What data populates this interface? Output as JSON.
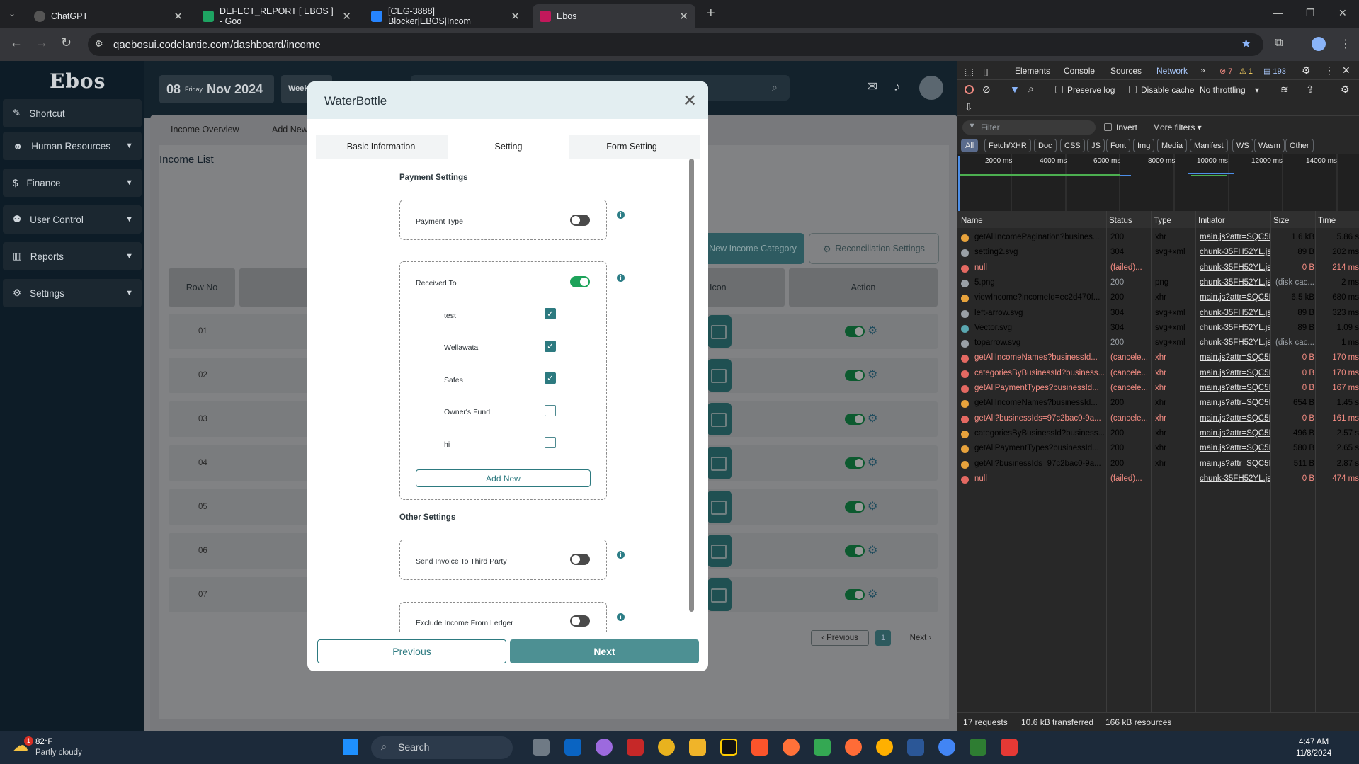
{
  "browser": {
    "tabs": [
      {
        "title": "ChatGPT",
        "icon": "chatgpt-icon"
      },
      {
        "title": "DEFECT_REPORT [ EBOS ] - Goo",
        "icon": "sheets-icon"
      },
      {
        "title": "[CEG-3888] Blocker|EBOS|Incom",
        "icon": "jira-icon"
      },
      {
        "title": "Ebos",
        "icon": "ebos-icon"
      }
    ],
    "url": "qaebosui.codelantic.com/dashboard/income"
  },
  "sidebar": {
    "logo": "Ebos",
    "items": [
      {
        "label": "Shortcut",
        "icon": "pin-icon"
      },
      {
        "label": "Human Resources",
        "icon": "people-icon"
      },
      {
        "label": "Finance",
        "icon": "dollar-icon"
      },
      {
        "label": "User Control",
        "icon": "user-control-icon"
      },
      {
        "label": "Reports",
        "icon": "chart-icon"
      },
      {
        "label": "Settings",
        "icon": "gear-icon"
      }
    ]
  },
  "topbar": {
    "day": "08",
    "weekday": "Friday",
    "month_year": "Nov 2024",
    "week": "Week"
  },
  "page": {
    "tabs": [
      "Income Overview",
      "Add New"
    ],
    "title": "Income List",
    "buttons": {
      "new_category": "New Income Category",
      "reconciliation": "Reconciliation Settings"
    },
    "columns": [
      "Row No",
      "Icon",
      "Action"
    ],
    "rows": [
      "01",
      "02",
      "03",
      "04",
      "05",
      "06",
      "07"
    ],
    "pagination": {
      "previous": "Previous",
      "page": "1",
      "next": "Next"
    }
  },
  "modal": {
    "title": "WaterBottle",
    "tabs": [
      "Basic Information",
      "Setting",
      "Form Setting"
    ],
    "payment_settings_title": "Payment Settings",
    "payment_type_label": "Payment Type",
    "received_to_label": "Received To",
    "received_to_options": [
      {
        "label": "test",
        "checked": true
      },
      {
        "label": "Wellawata",
        "checked": true
      },
      {
        "label": "Safes",
        "checked": true
      },
      {
        "label": "Owner's Fund",
        "checked": false
      },
      {
        "label": "hi",
        "checked": false
      }
    ],
    "add_new_label": "Add New",
    "other_settings_title": "Other Settings",
    "send_invoice_label": "Send Invoice To Third Party",
    "exclude_income_label": "Exclude Income From Ledger",
    "previous_label": "Previous",
    "next_label": "Next"
  },
  "devtools": {
    "tabs": [
      "Elements",
      "Console",
      "Sources",
      "Network"
    ],
    "errors": "7",
    "warnings": "1",
    "messages": "193",
    "preserve_log": "Preserve log",
    "disable_cache": "Disable cache",
    "throttling": "No throttling",
    "filter_placeholder": "Filter",
    "invert": "Invert",
    "more_filters": "More filters",
    "type_filters": [
      "All",
      "Fetch/XHR",
      "Doc",
      "CSS",
      "JS",
      "Font",
      "Img",
      "Media",
      "Manifest",
      "WS",
      "Wasm",
      "Other"
    ],
    "timeline_ticks": [
      "2000 ms",
      "4000 ms",
      "6000 ms",
      "8000 ms",
      "10000 ms",
      "12000 ms",
      "14000 ms"
    ],
    "columns": [
      "Name",
      "Status",
      "Type",
      "Initiator",
      "Size",
      "Time"
    ],
    "requests": [
      {
        "name": "getAllIncomePagination?busines...",
        "status": "200",
        "type": "xhr",
        "initiator": "main.js?attr=SQC5I",
        "size": "1.6 kB",
        "time": "5.86 s",
        "color": "#e8a33c"
      },
      {
        "name": "setting2.svg",
        "status": "304",
        "type": "svg+xml",
        "initiator": "chunk-35FH52YL.js",
        "size": "89 B",
        "time": "202 ms",
        "color": "#9aa0a6"
      },
      {
        "name": "null",
        "status": "(failed)...",
        "type": "",
        "initiator": "chunk-35FH52YL.js",
        "size": "0 B",
        "time": "214 ms",
        "color": "#e46962"
      },
      {
        "name": "5.png",
        "status": "200",
        "type": "png",
        "initiator": "chunk-35FH52YL.js",
        "size": "(disk cac...",
        "time": "2 ms",
        "color": "#9aa0a6"
      },
      {
        "name": "viewIncome?incomeId=ec2d470f...",
        "status": "200",
        "type": "xhr",
        "initiator": "main.js?attr=SQC5I",
        "size": "6.5 kB",
        "time": "680 ms",
        "color": "#e8a33c"
      },
      {
        "name": "left-arrow.svg",
        "status": "304",
        "type": "svg+xml",
        "initiator": "chunk-35FH52YL.js",
        "size": "89 B",
        "time": "323 ms",
        "color": "#9aa0a6"
      },
      {
        "name": "Vector.svg",
        "status": "304",
        "type": "svg+xml",
        "initiator": "chunk-35FH52YL.js",
        "size": "89 B",
        "time": "1.09 s",
        "color": "#5aa7b0"
      },
      {
        "name": "toparrow.svg",
        "status": "200",
        "type": "svg+xml",
        "initiator": "chunk-35FH52YL.js",
        "size": "(disk cac...",
        "time": "1 ms",
        "color": "#9aa0a6"
      },
      {
        "name": "getAllIncomeNames?businessId...",
        "status": "(cancele...",
        "type": "xhr",
        "initiator": "main.js?attr=SQC5I",
        "size": "0 B",
        "time": "170 ms",
        "color": "#e46962"
      },
      {
        "name": "categoriesByBusinessId?business...",
        "status": "(cancele...",
        "type": "xhr",
        "initiator": "main.js?attr=SQC5I",
        "size": "0 B",
        "time": "170 ms",
        "color": "#e46962"
      },
      {
        "name": "getAllPaymentTypes?businessId...",
        "status": "(cancele...",
        "type": "xhr",
        "initiator": "main.js?attr=SQC5I",
        "size": "0 B",
        "time": "167 ms",
        "color": "#e46962"
      },
      {
        "name": "getAllIncomeNames?businessId...",
        "status": "200",
        "type": "xhr",
        "initiator": "main.js?attr=SQC5I",
        "size": "654 B",
        "time": "1.45 s",
        "color": "#e8a33c"
      },
      {
        "name": "getAll?businessIds=97c2bac0-9a...",
        "status": "(cancele...",
        "type": "xhr",
        "initiator": "main.js?attr=SQC5I",
        "size": "0 B",
        "time": "161 ms",
        "color": "#e46962"
      },
      {
        "name": "categoriesByBusinessId?business...",
        "status": "200",
        "type": "xhr",
        "initiator": "main.js?attr=SQC5I",
        "size": "496 B",
        "time": "2.57 s",
        "color": "#e8a33c"
      },
      {
        "name": "getAllPaymentTypes?businessId...",
        "status": "200",
        "type": "xhr",
        "initiator": "main.js?attr=SQC5I",
        "size": "580 B",
        "time": "2.65 s",
        "color": "#e8a33c"
      },
      {
        "name": "getAll?businessIds=97c2bac0-9a...",
        "status": "200",
        "type": "xhr",
        "initiator": "main.js?attr=SQC5I",
        "size": "511 B",
        "time": "2.87 s",
        "color": "#e8a33c"
      },
      {
        "name": "null",
        "status": "(failed)...",
        "type": "",
        "initiator": "chunk-35FH52YL.js",
        "size": "0 B",
        "time": "474 ms",
        "color": "#e46962"
      }
    ],
    "summary": {
      "requests": "17 requests",
      "transferred": "10.6 kB transferred",
      "resources": "166 kB resources"
    }
  },
  "taskbar": {
    "temp": "82°F",
    "weather": "Partly cloudy",
    "search": "Search",
    "time": "4:47 AM",
    "date": "11/8/2024",
    "badge": "1"
  }
}
